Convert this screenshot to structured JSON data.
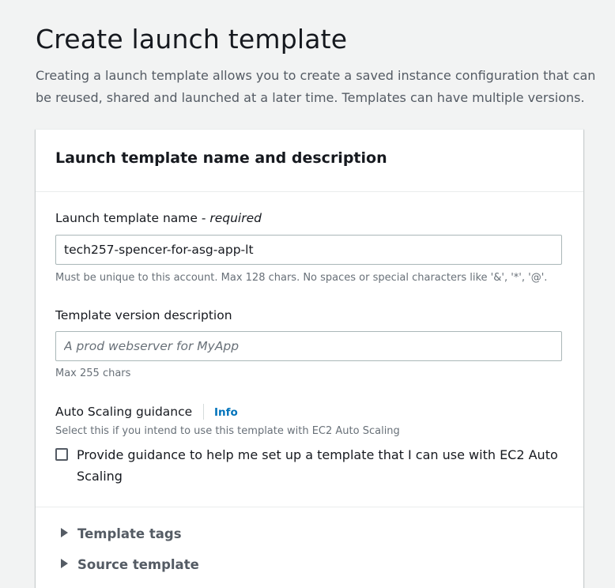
{
  "header": {
    "title": "Create launch template",
    "description": "Creating a launch template allows you to create a saved instance configuration that can be reused, shared and launched at a later time. Templates can have multiple versions."
  },
  "panel": {
    "title": "Launch template name and description",
    "name_field": {
      "label": "Launch template name - ",
      "required": "required",
      "value": "tech257-spencer-for-asg-app-lt",
      "hint": "Must be unique to this account. Max 128 chars. No spaces or special characters like '&', '*', '@'."
    },
    "description_field": {
      "label": "Template version description",
      "placeholder": "A prod webserver for MyApp",
      "value": "",
      "hint": "Max 255 chars"
    },
    "auto_scaling": {
      "label": "Auto Scaling guidance",
      "info": "Info",
      "hint": "Select this if you intend to use this template with EC2 Auto Scaling",
      "checkbox_label": "Provide guidance to help me set up a template that I can use with EC2 Auto Scaling",
      "checked": false
    },
    "expanders": [
      {
        "label": "Template tags"
      },
      {
        "label": "Source template"
      }
    ]
  },
  "colors": {
    "background": "#f2f3f3",
    "link": "#0073bb",
    "text": "#16191f",
    "muted": "#687078"
  }
}
